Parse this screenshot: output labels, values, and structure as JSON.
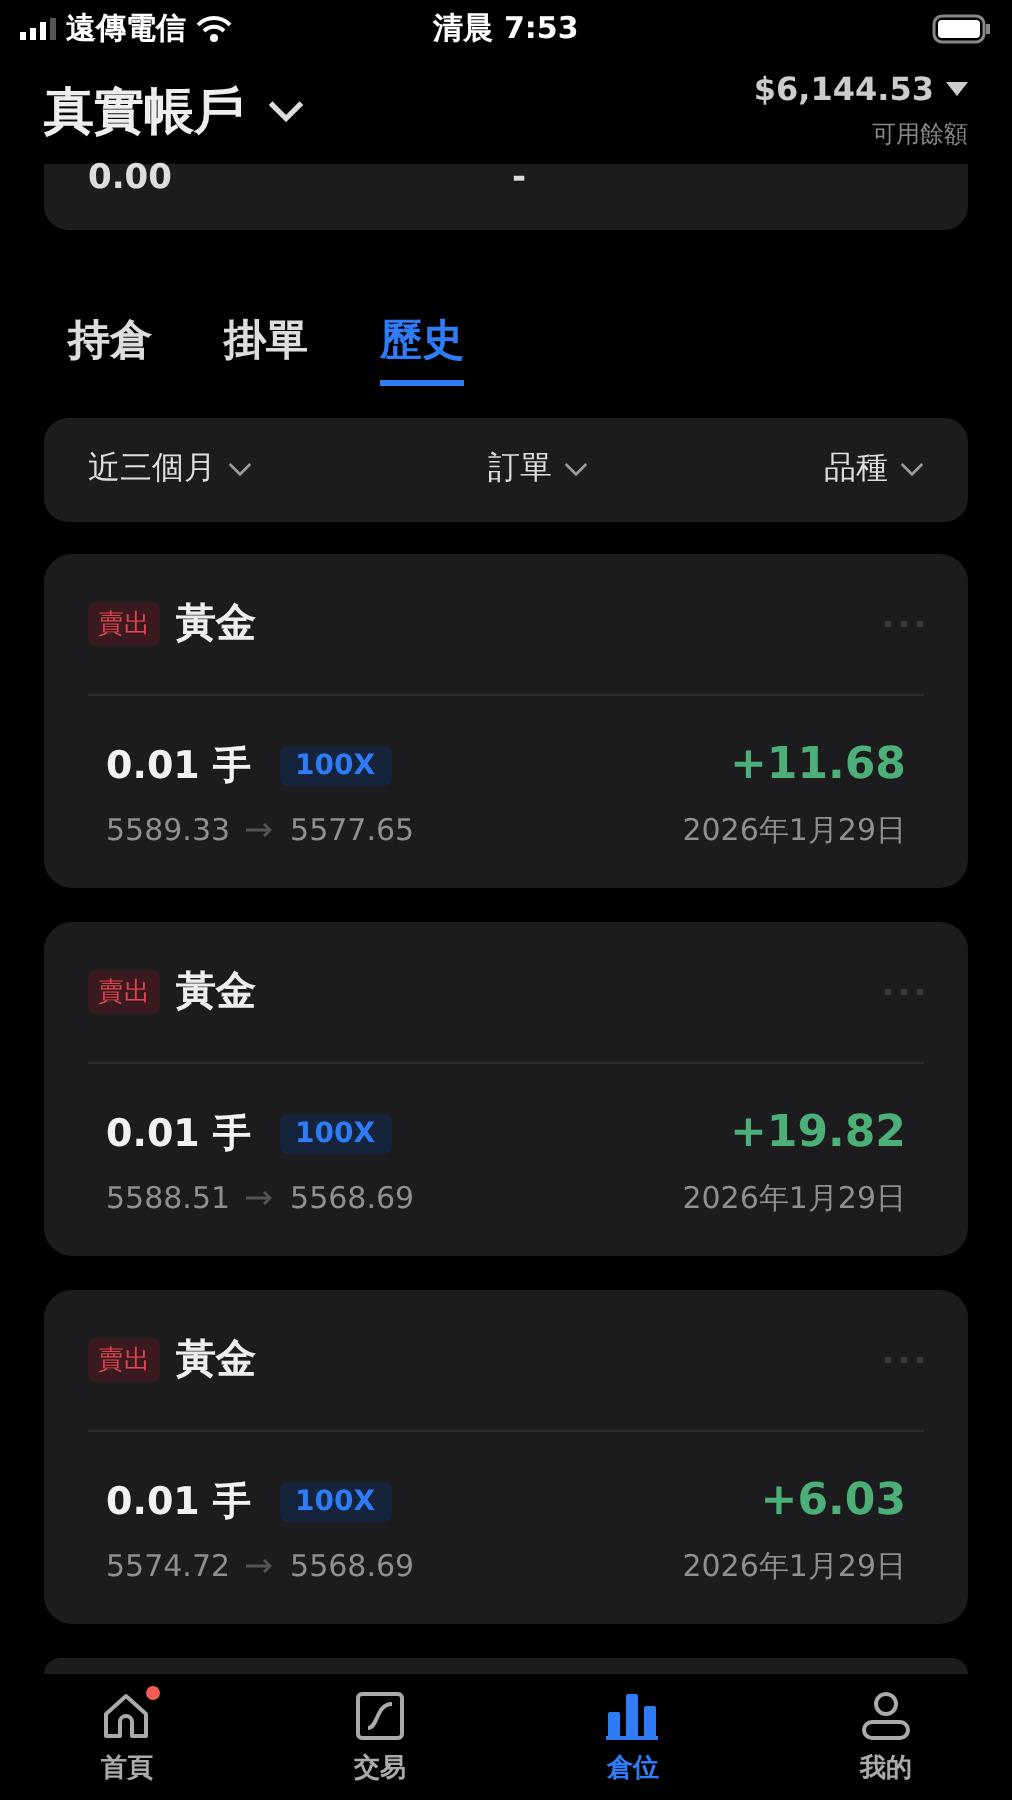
{
  "status_bar": {
    "carrier": "遠傳電信",
    "time": "清晨 7:53"
  },
  "header": {
    "account": "真實帳戶",
    "balance": "$6,144.53",
    "balance_label": "可用餘額"
  },
  "summary": {
    "values": [
      "0.00",
      "-"
    ]
  },
  "tabs": [
    {
      "label": "持倉",
      "selected": false
    },
    {
      "label": "掛單",
      "selected": false
    },
    {
      "label": "歷史",
      "selected": true
    }
  ],
  "filters": [
    "近三個月",
    "訂單",
    "品種"
  ],
  "orders": [
    {
      "side": "賣出",
      "symbol": "黃金",
      "lots": "0.01 手",
      "leverage": "100X",
      "pnl": "+11.68",
      "open": "5589.33",
      "close": "5577.65",
      "date": "2026年1月29日"
    },
    {
      "side": "賣出",
      "symbol": "黃金",
      "lots": "0.01 手",
      "leverage": "100X",
      "pnl": "+19.82",
      "open": "5588.51",
      "close": "5568.69",
      "date": "2026年1月29日"
    },
    {
      "side": "賣出",
      "symbol": "黃金",
      "lots": "0.01 手",
      "leverage": "100X",
      "pnl": "+6.03",
      "open": "5574.72",
      "close": "5568.69",
      "date": "2026年1月29日"
    }
  ],
  "nav": [
    {
      "kind": "home",
      "label": "首頁",
      "selected": false,
      "badge": true
    },
    {
      "kind": "trade",
      "label": "交易",
      "selected": false,
      "badge": false
    },
    {
      "kind": "positions",
      "label": "倉位",
      "selected": true,
      "badge": false
    },
    {
      "kind": "profile",
      "label": "我的",
      "selected": false,
      "badge": false
    }
  ]
}
